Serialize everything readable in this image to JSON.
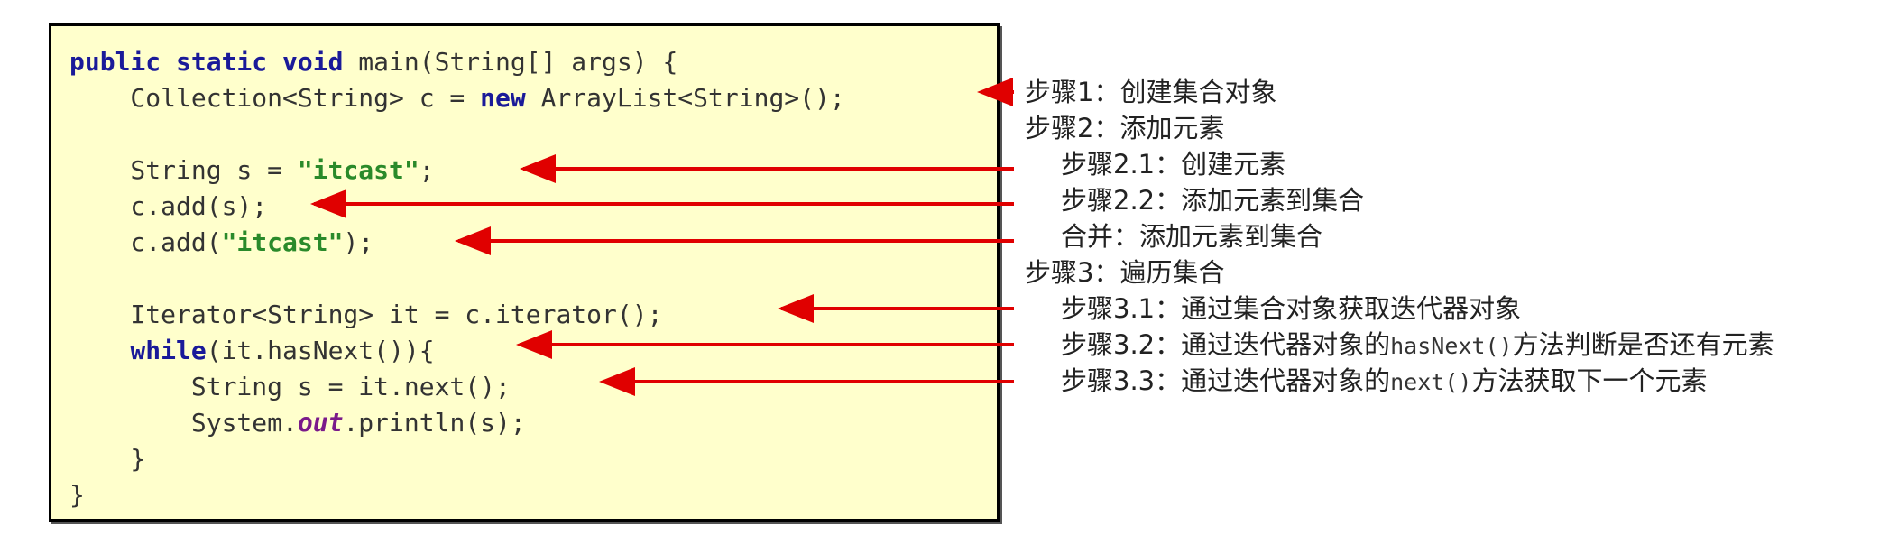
{
  "code": {
    "l1": {
      "kw1": "public static void",
      "rest": " main(String[] args) {"
    },
    "l2": {
      "pre": "    Collection<String> c = ",
      "kw": "new",
      "post": " ArrayList<String>();"
    },
    "l3": {
      "pre": "    String s = ",
      "str": "\"itcast\"",
      "post": ";"
    },
    "l4": {
      "text": "    c.add(s);"
    },
    "l5": {
      "pre": "    c.add(",
      "str": "\"itcast\"",
      "post": ");"
    },
    "l6": {
      "text": "    Iterator<String> it = c.iterator();"
    },
    "l7": {
      "kw": "    while",
      "post": "(it.hasNext()){"
    },
    "l8": {
      "text": "        String s = it.next();"
    },
    "l9": {
      "pre": "        System.",
      "fld": "out",
      "post": ".println(s);"
    },
    "l10": {
      "text": "    }"
    },
    "l11": {
      "text": "}"
    }
  },
  "notes": {
    "n1": "步骤1：创建集合对象",
    "n2": "步骤2：添加元素",
    "n3": "步骤2.1：创建元素",
    "n4": "步骤2.2：添加元素到集合",
    "n5": "合并：添加元素到集合",
    "n6": "步骤3：遍历集合",
    "n7": "步骤3.1：通过集合对象获取迭代器对象",
    "n8": {
      "pre": "步骤3.2：通过迭代器对象的",
      "code": "hasNext()",
      "post": "方法判断是否还有元素"
    },
    "n9": {
      "pre": "步骤3.3：通过迭代器对象的",
      "code": "next()",
      "post": "方法获取下一个元素"
    }
  },
  "colors": {
    "box_bg": "#ffffcc",
    "arrow": "#e00000",
    "keyword": "#1a1a99",
    "string": "#2a8a2a"
  }
}
